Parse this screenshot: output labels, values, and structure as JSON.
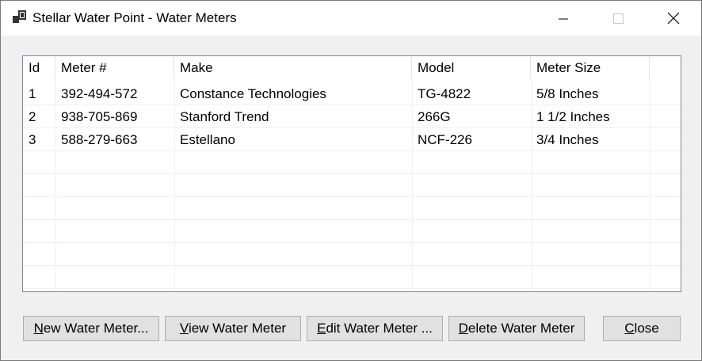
{
  "window": {
    "title": "Stellar Water Point - Water Meters"
  },
  "table": {
    "columns": [
      "Id",
      "Meter #",
      "Make",
      "Model",
      "Meter Size"
    ],
    "rows": [
      [
        "1",
        "392-494-572",
        "Constance Technologies",
        "TG-4822",
        "5/8 Inches"
      ],
      [
        "2",
        "938-705-869",
        "Stanford Trend",
        "266G",
        "1 1/2 Inches"
      ],
      [
        "3",
        "588-279-663",
        "Estellano",
        "NCF-226",
        "3/4 Inches"
      ]
    ]
  },
  "buttons": {
    "new": {
      "mnemonic": "N",
      "rest": "ew Water Meter..."
    },
    "view": {
      "mnemonic": "V",
      "rest": "iew Water Meter"
    },
    "edit": {
      "mnemonic": "E",
      "rest": "dit Water Meter ..."
    },
    "delete": {
      "mnemonic": "D",
      "rest": "elete Water Meter"
    },
    "close": {
      "mnemonic": "C",
      "rest": "lose"
    }
  }
}
